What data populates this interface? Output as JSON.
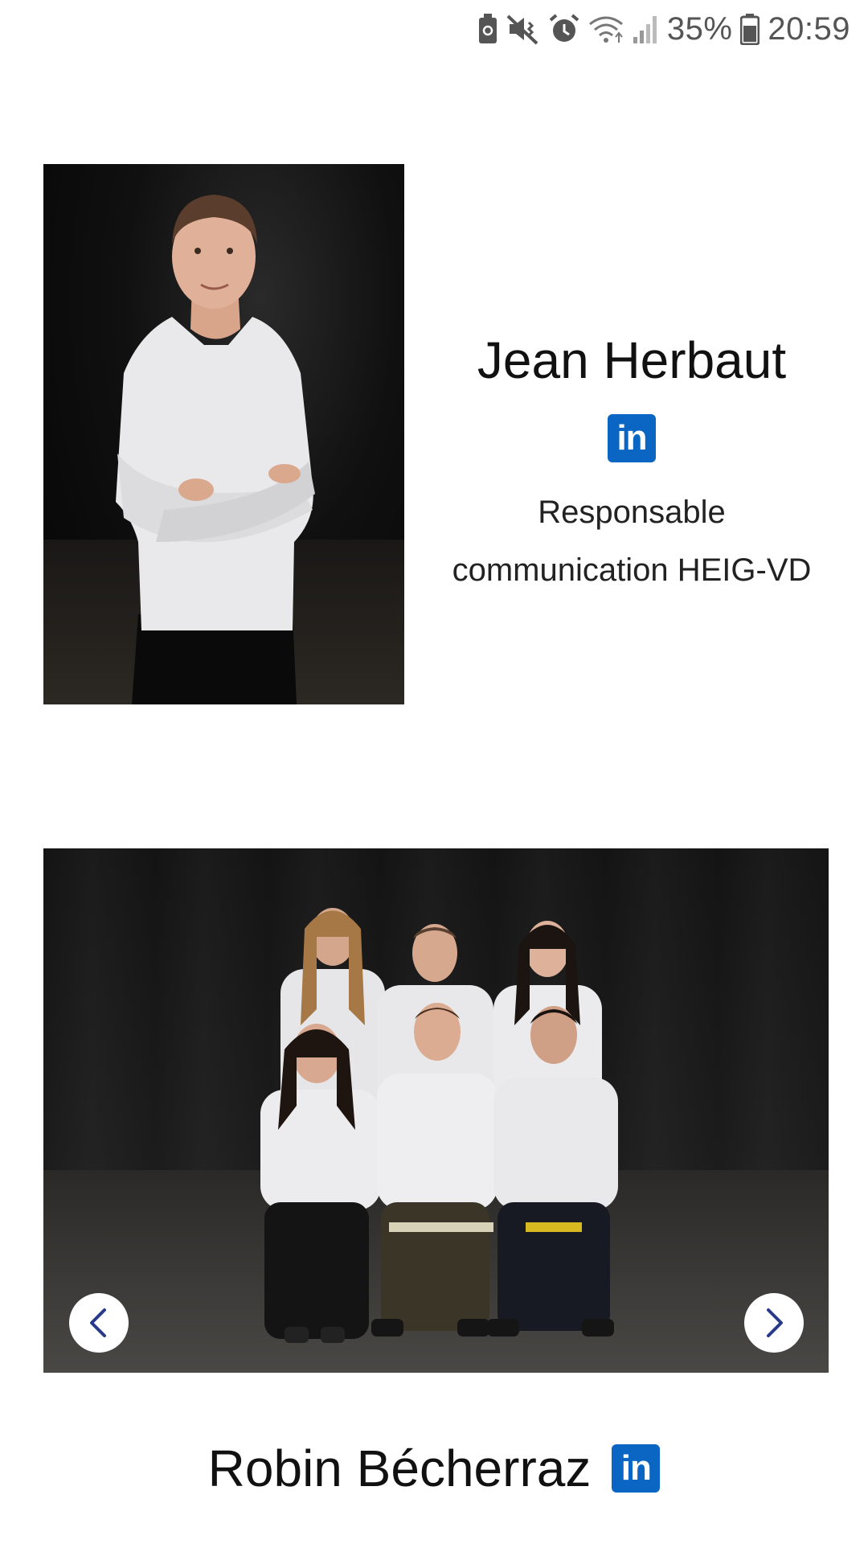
{
  "status_bar": {
    "icons": [
      "battery-saver-icon",
      "mute-icon",
      "alarm-icon",
      "wifi-icon",
      "signal-icon",
      "battery-icon"
    ],
    "battery_percent": "35%",
    "time": "20:59"
  },
  "profile_card": {
    "name": "Jean Herbaut",
    "linkedin_label": "in",
    "role_line1": "Responsable",
    "role_line2": "communication HEIG-VD"
  },
  "team_carousel": {
    "prev_icon": "chevron-left-icon",
    "next_icon": "chevron-right-icon"
  },
  "next_profile": {
    "name": "Robin Bécherraz",
    "linkedin_label": "in"
  },
  "colors": {
    "linkedin": "#0a66c2",
    "nav_chevron": "#2a3a8a",
    "text": "#111111"
  }
}
